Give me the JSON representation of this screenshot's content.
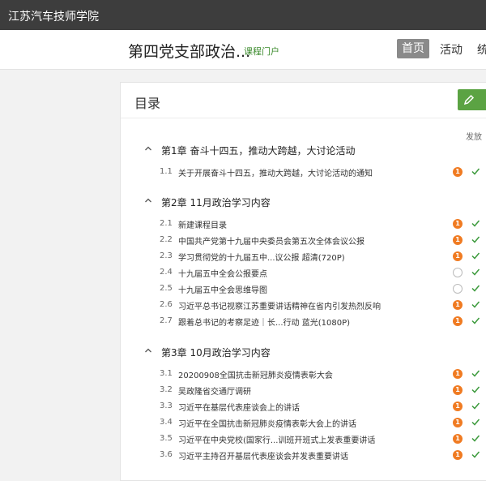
{
  "app": {
    "title": "江苏汽车技师学院"
  },
  "header": {
    "course_title": "第四党支部政治...",
    "portal_link": "课程门户",
    "nav": {
      "home": "首页",
      "activity": "活动",
      "more": "统"
    }
  },
  "panel": {
    "title": "目录",
    "column_header": "发放"
  },
  "chapters": [
    {
      "number": "第1章",
      "title": "奋斗十四五，推动大跨越，大讨论活动",
      "sections": [
        {
          "num": "1.1",
          "title": "关于开展奋斗十四五，推动大跨越，大讨论活动的通知",
          "badge": "1"
        }
      ]
    },
    {
      "number": "第2章",
      "title": "11月政治学习内容",
      "sections": [
        {
          "num": "2.1",
          "title": "新建课程目录",
          "badge": "1"
        },
        {
          "num": "2.2",
          "title": "中国共产党第十九届中央委员会第五次全体会议公报",
          "badge": "1"
        },
        {
          "num": "2.3",
          "title": "学习贯彻党的十九届五中...议公报 超清(720P)",
          "badge": "1"
        },
        {
          "num": "2.4",
          "title": "十九届五中全会公报要点",
          "badge": ""
        },
        {
          "num": "2.5",
          "title": "十九届五中全会思维导图",
          "badge": ""
        },
        {
          "num": "2.6",
          "title": "习近平总书记视察江苏重要讲话精神在省内引发热烈反响",
          "badge": "1"
        },
        {
          "num": "2.7",
          "title": "跟着总书记的考察足迹｜长...行动 蓝光(1080P)",
          "badge": "1"
        }
      ]
    },
    {
      "number": "第3章",
      "title": "10月政治学习内容",
      "sections": [
        {
          "num": "3.1",
          "title": "20200908全国抗击新冠肺炎疫情表彰大会",
          "badge": "1"
        },
        {
          "num": "3.2",
          "title": "吴政隆省交通厅调研",
          "badge": "1"
        },
        {
          "num": "3.3",
          "title": "习近平在基层代表座谈会上的讲话",
          "badge": "1"
        },
        {
          "num": "3.4",
          "title": "习近平在全国抗击新冠肺炎疫情表彰大会上的讲话",
          "badge": "1"
        },
        {
          "num": "3.5",
          "title": "习近平在中央党校(国家行...训班开班式上发表重要讲话",
          "badge": "1"
        },
        {
          "num": "3.6",
          "title": "习近平主持召开基层代表座谈会并发表重要讲话",
          "badge": "1"
        }
      ]
    }
  ],
  "colors": {
    "topbar": "#3d3d3d",
    "accent_green": "#5ba343",
    "badge_orange": "#f07b22",
    "check_green": "#3c9a3c"
  }
}
